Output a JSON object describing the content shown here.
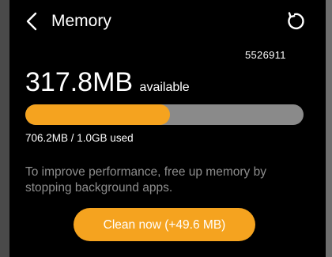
{
  "header": {
    "title": "Memory",
    "back_icon": "chevron-left-icon",
    "refresh_icon": "refresh-icon"
  },
  "code": "5526911",
  "memory": {
    "available_value": "317.8MB",
    "available_label": "available",
    "used_text": "706.2MB / 1.0GB used",
    "used_fraction": 0.52
  },
  "hint": "To improve performance, free up memory by stopping background apps.",
  "clean_button_label": "Clean now (+49.6 MB)",
  "colors": {
    "accent": "#f5a31f",
    "track": "#8a8a8a",
    "background": "#000000",
    "hint_text": "#8e8e8e"
  }
}
